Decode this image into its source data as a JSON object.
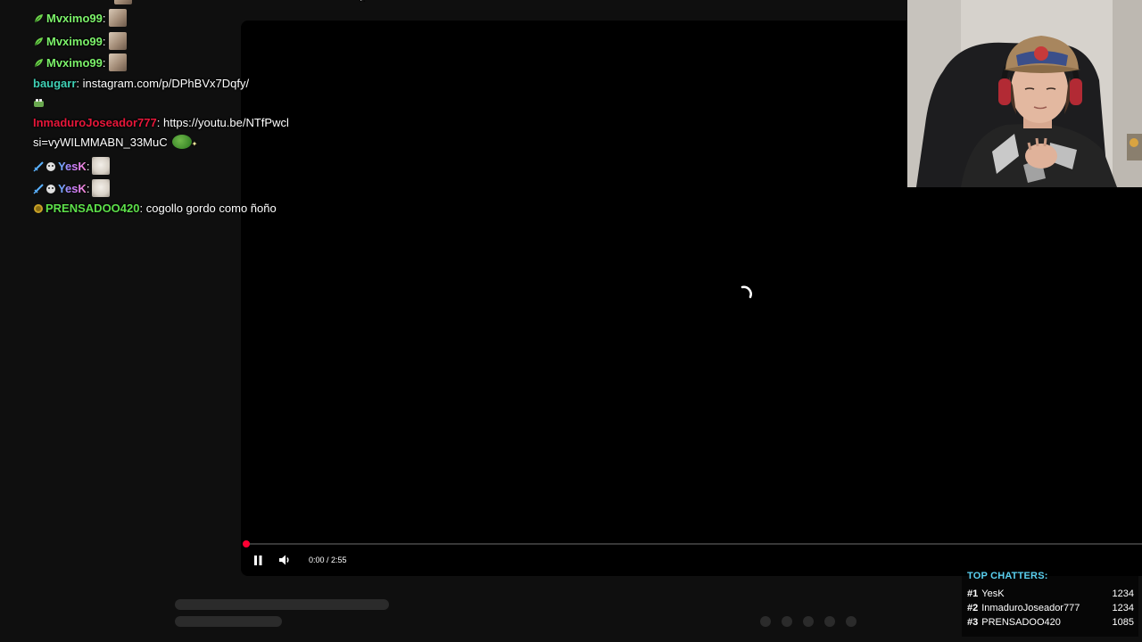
{
  "colors": {
    "mvximo": "#7cf26a",
    "baugarr": "#3fd0b5",
    "inmaduro": "#e8173a",
    "yesk": "#b38cff",
    "prensado": "#5de04a",
    "progress": "#ff0033",
    "top_chatters_title": "#5ad0f0"
  },
  "chat": {
    "messages": [
      {
        "user": "Mvximo99",
        "sep": ":",
        "text": "",
        "badge": "leaf-badge-icon",
        "emote": "cat-emote-icon"
      },
      {
        "user": "Mvximo99",
        "sep": ":",
        "text": "",
        "badge": "leaf-badge-icon",
        "emote": "cat-emote-icon"
      },
      {
        "user": "Mvximo99",
        "sep": ":",
        "text": "",
        "badge": "leaf-badge-icon",
        "emote": "cat-emote-icon"
      },
      {
        "user": "baugarr",
        "sep": ":",
        "text": "instagram.com/p/DPhBVx7Dqfy/"
      },
      {
        "user": "InmaduroJoseador777",
        "sep": ":",
        "text": "https://youtu.be/NTfPwcl",
        "text_cont": "si=vyWILMMABN_33MuC"
      },
      {
        "user": "YesK",
        "sep": ":",
        "text": "",
        "badge": "sword-badge-icon",
        "emote": "white-cat-emote-icon"
      },
      {
        "user": "YesK",
        "sep": ":",
        "text": "",
        "badge": "sword-badge-icon",
        "emote": "white-cat-emote-icon"
      },
      {
        "user": "PRENSADOO420",
        "sep": ":",
        "text": "cogollo gordo como ñoño",
        "badge": "coin-badge-icon"
      }
    ]
  },
  "player": {
    "time": "0:00 / 2:55",
    "progress_fraction": 0.0,
    "state": "loading"
  },
  "top_chatters": {
    "title": "TOP CHATTERS:",
    "rows": [
      {
        "rank": "#1",
        "name": "YesK",
        "score": "1234"
      },
      {
        "rank": "#2",
        "name": "InmaduroJoseador777",
        "score": "1234"
      },
      {
        "rank": "#3",
        "name": "PRENSADOO420",
        "score": "1085"
      }
    ]
  }
}
